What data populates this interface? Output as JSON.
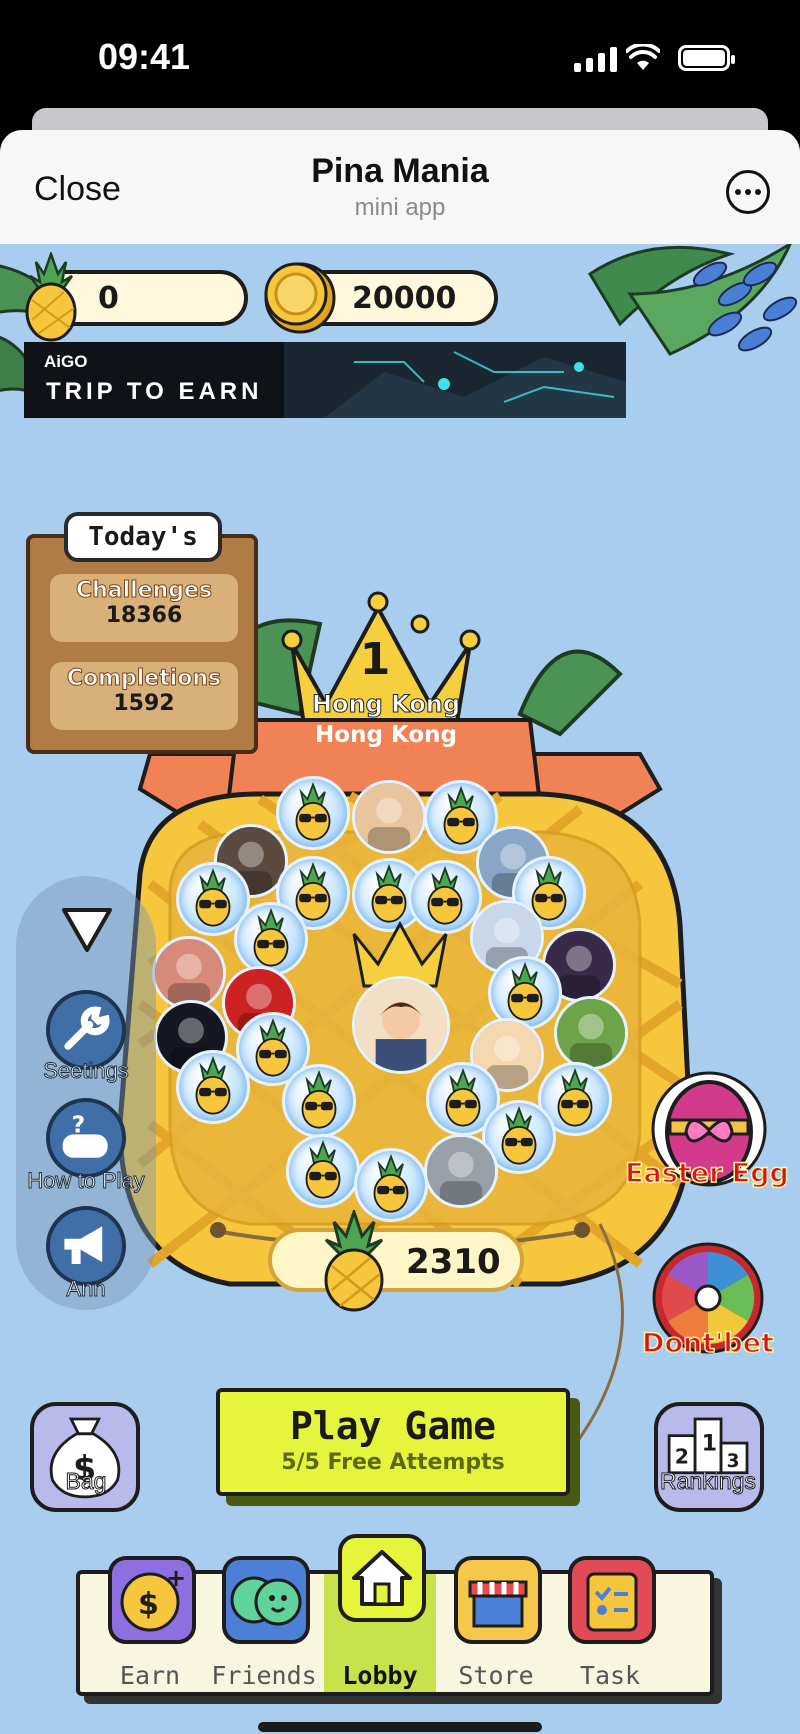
{
  "status_bar": {
    "time": "09:41"
  },
  "header": {
    "close_label": "Close",
    "title": "Pina Mania",
    "subtitle": "mini app",
    "more_icon": "ellipsis-circle-icon"
  },
  "currency": {
    "pineapples": "0",
    "coins": "20000"
  },
  "banner": {
    "brand": "AiGO",
    "slogan": "TRIP TO EARN"
  },
  "today": {
    "title": "Today's",
    "challenges_label": "Challenges",
    "challenges_value": "18366",
    "completions_label": "Completions",
    "completions_value": "1592"
  },
  "leader": {
    "rank": "1",
    "name": "Hong Kong",
    "region": "Hong Kong"
  },
  "score": "2310",
  "side_menu": {
    "settings": "Seetings",
    "how_to_play": "How to Play",
    "announcement": "Ann"
  },
  "right_buttons": {
    "easter_egg": "Easter Egg",
    "dont_bet": "Dont'bet"
  },
  "bag_label": "Bag",
  "rankings_label": "Rankings",
  "play": {
    "label": "Play Game",
    "attempts": "5/5 Free Attempts"
  },
  "nav": {
    "earn": "Earn",
    "friends": "Friends",
    "lobby": "Lobby",
    "store": "Store",
    "task": "Task"
  },
  "colors": {
    "sky": "#a9cdef",
    "play_button": "#e5f53b",
    "nav_active": "#c7e24a",
    "pineapple": "#f6c73d"
  }
}
